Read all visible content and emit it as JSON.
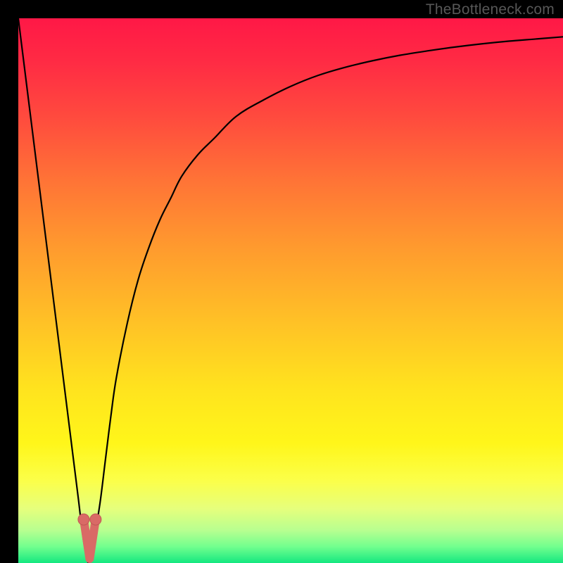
{
  "watermark": {
    "text": "TheBottleneck.com"
  },
  "colors": {
    "black": "#000000",
    "curve": "#000000",
    "marker_fill": "#d96a66",
    "marker_stroke": "#c15854",
    "gradient_stops": [
      {
        "offset": 0.0,
        "color": "#ff1846"
      },
      {
        "offset": 0.08,
        "color": "#ff2b44"
      },
      {
        "offset": 0.18,
        "color": "#ff4a3e"
      },
      {
        "offset": 0.3,
        "color": "#ff7436"
      },
      {
        "offset": 0.42,
        "color": "#ff9a2e"
      },
      {
        "offset": 0.56,
        "color": "#ffc226"
      },
      {
        "offset": 0.68,
        "color": "#ffe31e"
      },
      {
        "offset": 0.78,
        "color": "#fff61a"
      },
      {
        "offset": 0.85,
        "color": "#fbff4a"
      },
      {
        "offset": 0.9,
        "color": "#e6ff7c"
      },
      {
        "offset": 0.94,
        "color": "#b8ff90"
      },
      {
        "offset": 0.97,
        "color": "#72ff8e"
      },
      {
        "offset": 1.0,
        "color": "#15e880"
      }
    ]
  },
  "chart_data": {
    "type": "line",
    "title": "",
    "xlabel": "",
    "ylabel": "",
    "xlim": [
      0,
      100
    ],
    "ylim": [
      0,
      100
    ],
    "series": [
      {
        "name": "bottleneck-curve",
        "x": [
          0,
          1,
          2,
          3,
          4,
          5,
          6,
          7,
          8,
          9,
          10,
          11,
          12,
          13,
          14,
          15,
          16,
          17,
          18,
          20,
          22,
          24,
          26,
          28,
          30,
          33,
          36,
          40,
          45,
          50,
          55,
          60,
          65,
          70,
          75,
          80,
          85,
          90,
          95,
          100
        ],
        "y": [
          100,
          92,
          84,
          76,
          68,
          60,
          52,
          44,
          36,
          28,
          20,
          12,
          4,
          0,
          5,
          11,
          19,
          27,
          34,
          44,
          52,
          58,
          63,
          67,
          71,
          75,
          78,
          82,
          85,
          87.5,
          89.5,
          91,
          92.2,
          93.2,
          94,
          94.7,
          95.3,
          95.8,
          96.2,
          96.6
        ]
      }
    ],
    "markers": [
      {
        "name": "marker-left",
        "x": 12.0,
        "y": 8.0
      },
      {
        "name": "marker-right",
        "x": 14.2,
        "y": 8.0
      }
    ],
    "annotations": []
  }
}
